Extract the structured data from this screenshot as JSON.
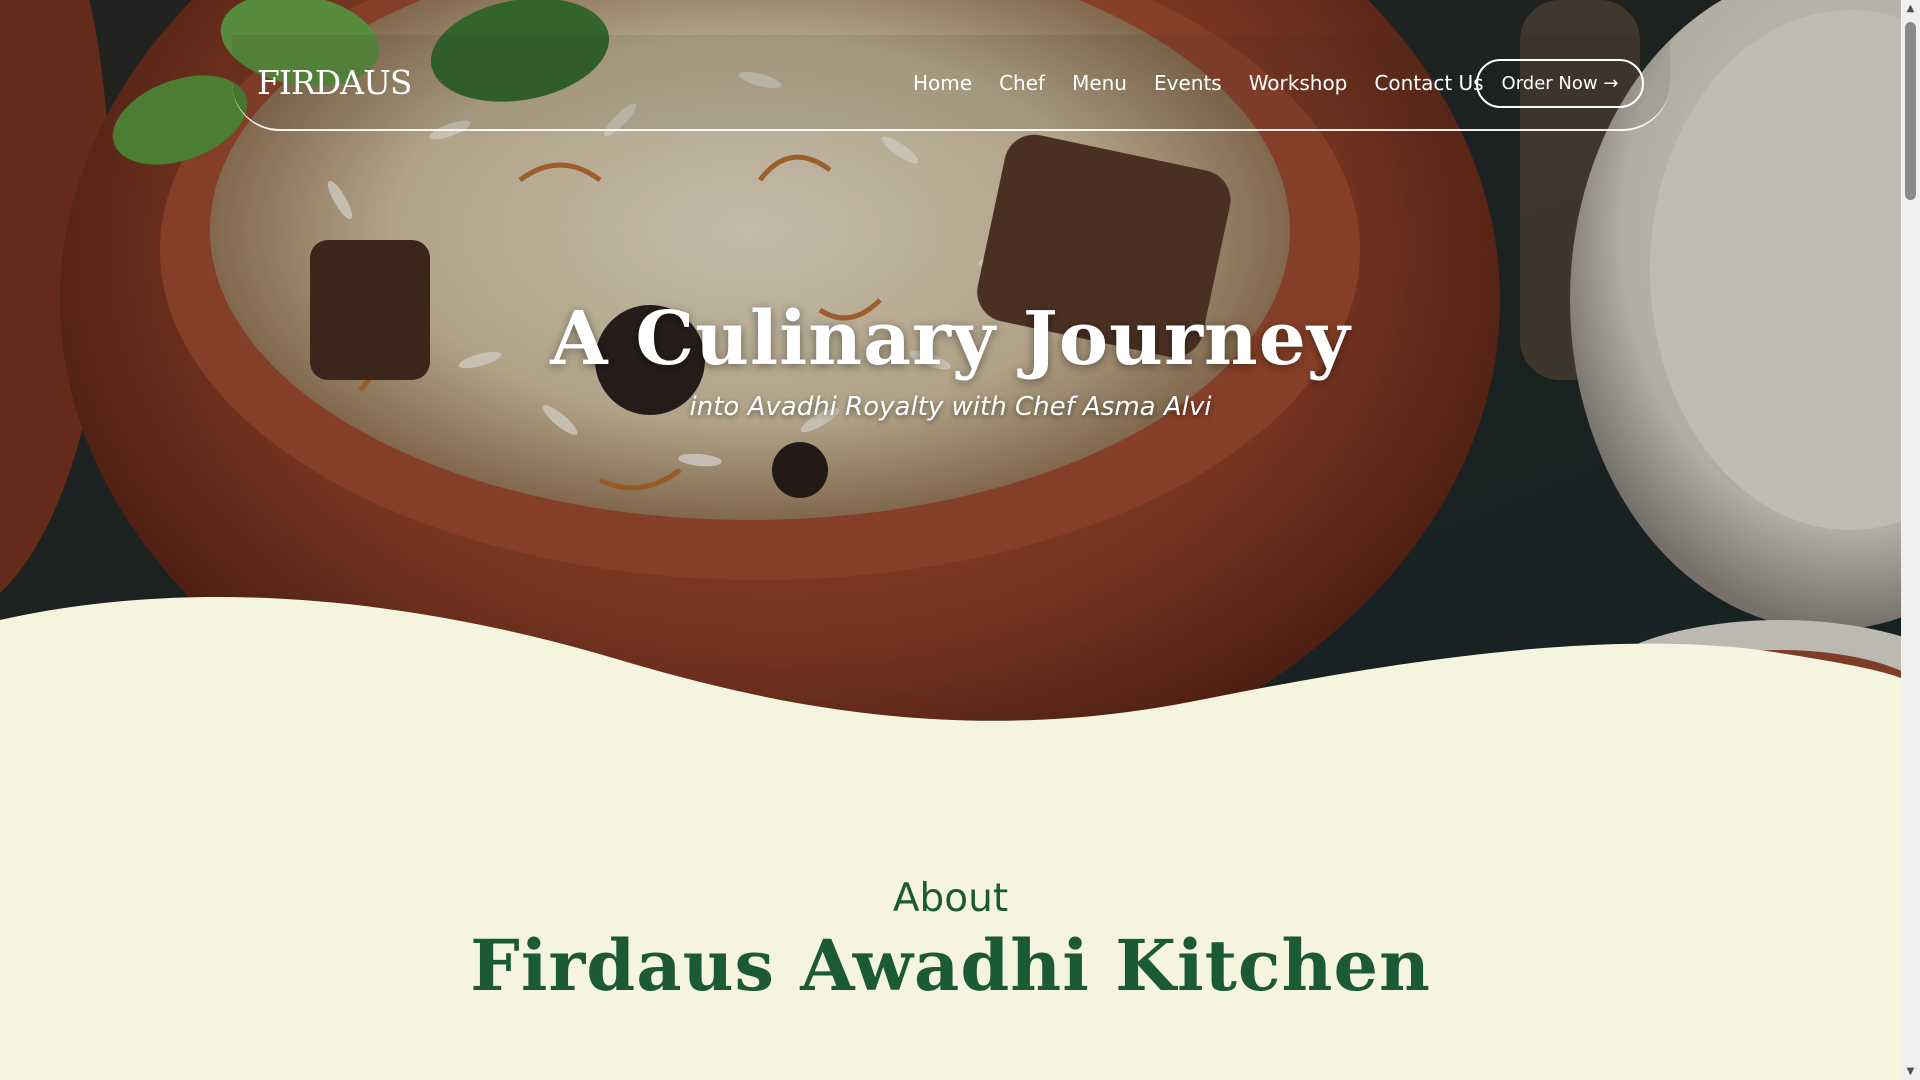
{
  "nav": {
    "brand": "FIRDAUS",
    "links": [
      "Home",
      "Chef",
      "Menu",
      "Events",
      "Workshop",
      "Contact Us"
    ],
    "order_label": "Order Now →"
  },
  "hero": {
    "title": "A Culinary Journey",
    "subtitle": "into Avadhi Royalty with Chef Asma Alvi"
  },
  "about": {
    "kicker": "About",
    "title": "Firdaus Awadhi Kitchen"
  },
  "colors": {
    "cream": "#f5f4df",
    "green": "#1c5a36",
    "clay": "#9b4a31"
  }
}
